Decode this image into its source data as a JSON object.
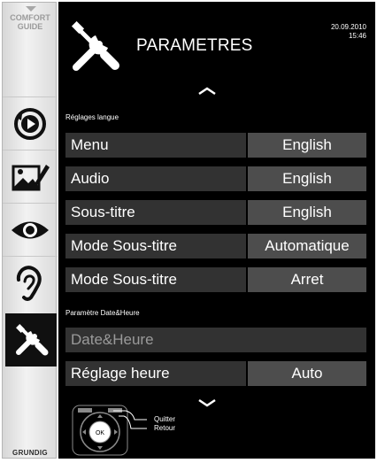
{
  "sidebar": {
    "comfort_guide": [
      "COMFORT",
      "GUIDE"
    ],
    "icons": [
      "playback-icon",
      "photo-edit-icon",
      "eye-icon",
      "ear-icon",
      "tools-icon"
    ],
    "active": "tools-icon",
    "brand": "GRUNDIG"
  },
  "header": {
    "title": "PARAMETRES",
    "date": "20.09.2010",
    "time": "15:46",
    "icon": "tools-icon"
  },
  "language_section": {
    "heading": "Réglages langue",
    "rows": [
      {
        "label": "Menu",
        "value": "English"
      },
      {
        "label": "Audio",
        "value": "English"
      },
      {
        "label": "Sous-titre",
        "value": "English"
      },
      {
        "label": "Mode Sous-titre",
        "value": "Automatique"
      },
      {
        "label": "Mode Sous-titre",
        "value": "Arret"
      }
    ]
  },
  "datetime_section": {
    "heading": "Paramètre Date&Heure",
    "rows": [
      {
        "label": "Date&Heure",
        "value": ""
      },
      {
        "label": "Réglage heure",
        "value": "Auto"
      }
    ]
  },
  "footer": {
    "ok_label": "OK",
    "quit": "Quitter",
    "back": "Retour"
  },
  "colors": {
    "panel_bg": "#000000",
    "label_bg": "#323232",
    "value_bg": "#4d4d4d",
    "disabled_text": "#9a9a9a",
    "sidebar_bg": "#e6e6e6"
  }
}
